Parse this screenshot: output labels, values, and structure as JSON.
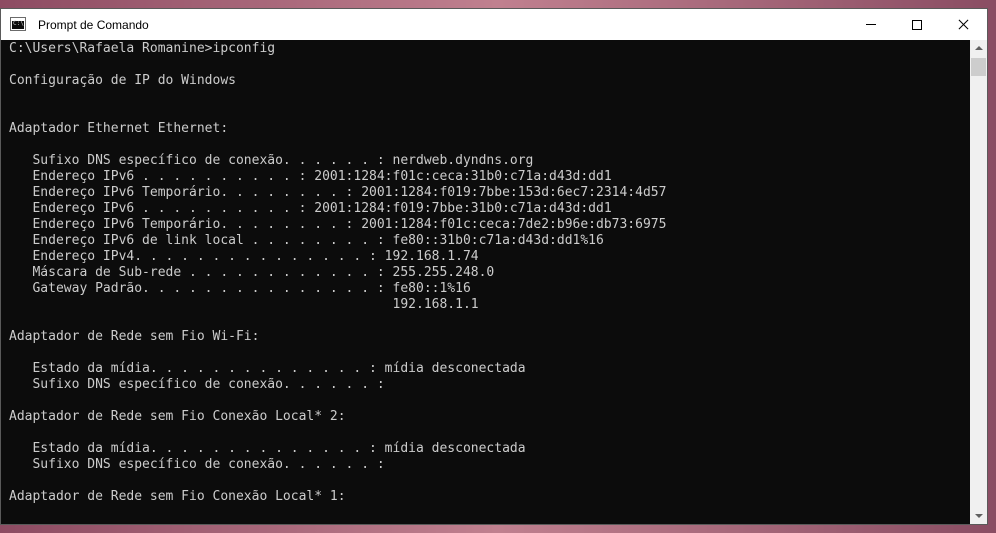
{
  "window": {
    "title": "Prompt de Comando",
    "icon": "cmd-icon",
    "icon_glyph": "C:\\"
  },
  "console": {
    "lines": [
      "C:\\Users\\Rafaela Romanine>ipconfig",
      "",
      "Configuração de IP do Windows",
      "",
      "",
      "Adaptador Ethernet Ethernet:",
      "",
      "   Sufixo DNS específico de conexão. . . . . . : nerdweb.dyndns.org",
      "   Endereço IPv6 . . . . . . . . . . : 2001:1284:f01c:ceca:31b0:c71a:d43d:dd1",
      "   Endereço IPv6 Temporário. . . . . . . . : 2001:1284:f019:7bbe:153d:6ec7:2314:4d57",
      "   Endereço IPv6 . . . . . . . . . . : 2001:1284:f019:7bbe:31b0:c71a:d43d:dd1",
      "   Endereço IPv6 Temporário. . . . . . . . : 2001:1284:f01c:ceca:7de2:b96e:db73:6975",
      "   Endereço IPv6 de link local . . . . . . . . : fe80::31b0:c71a:d43d:dd1%16",
      "   Endereço IPv4. . . . . . . . . . . . . . . : 192.168.1.74",
      "   Máscara de Sub-rede . . . . . . . . . . . . : 255.255.248.0",
      "   Gateway Padrão. . . . . . . . . . . . . . . : fe80::1%16",
      "                                                 192.168.1.1",
      "",
      "Adaptador de Rede sem Fio Wi-Fi:",
      "",
      "   Estado da mídia. . . . . . . . . . . . . . : mídia desconectada",
      "   Sufixo DNS específico de conexão. . . . . . :",
      "",
      "Adaptador de Rede sem Fio Conexão Local* 2:",
      "",
      "   Estado da mídia. . . . . . . . . . . . . . : mídia desconectada",
      "   Sufixo DNS específico de conexão. . . . . . :",
      "",
      "Adaptador de Rede sem Fio Conexão Local* 1:"
    ]
  },
  "colors": {
    "console_background": "#0c0c0c",
    "console_text": "#cccccc",
    "titlebar_background": "#ffffff"
  }
}
